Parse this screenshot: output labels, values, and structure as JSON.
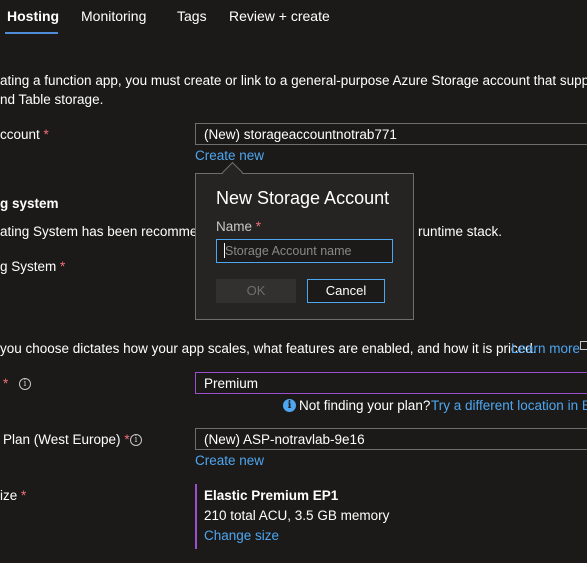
{
  "tabs": [
    {
      "label": "Hosting",
      "active": true
    },
    {
      "label": "Monitoring"
    },
    {
      "label": "Tags"
    },
    {
      "label": "Review + create"
    }
  ],
  "intro": {
    "line1": "ating a function app, you must create or link to a general-purpose Azure Storage account that supports",
    "line2": "nd Table storage."
  },
  "storage": {
    "label": "ccount",
    "required": "*",
    "value": "(New) storageaccountnotrab771",
    "create_new": "Create new"
  },
  "os": {
    "heading": "g system",
    "desc_left": "ating System has been recommen",
    "desc_right": "runtime stack.",
    "label": "g System",
    "required": "*"
  },
  "plan_section": {
    "desc": "you choose dictates how your app scales, what features are enabled, and how it is priced.",
    "learn_more": "Learn more"
  },
  "plan_type": {
    "required": "*",
    "value": "Premium",
    "hint_text": "Not finding your plan?",
    "hint_link": "Try a different location in Ba"
  },
  "app_plan": {
    "label": "Plan (West Europe)",
    "required": "*",
    "value": "(New) ASP-notravlab-9e16",
    "create_new": "Create new"
  },
  "sku": {
    "label": "ize",
    "required": "*",
    "title": "Elastic Premium EP1",
    "detail": "210 total ACU, 3.5 GB memory",
    "change": "Change size"
  },
  "callout": {
    "title": "New Storage Account",
    "name_label": "Name",
    "required": "*",
    "placeholder": "Storage Account name",
    "ok": "OK",
    "cancel": "Cancel"
  },
  "colors": {
    "background": "#1b1a19",
    "link": "#4ea6f0",
    "required": "#f1707b",
    "accent_purple": "#9b4fce",
    "tab_underline": "#4f8bd6"
  }
}
